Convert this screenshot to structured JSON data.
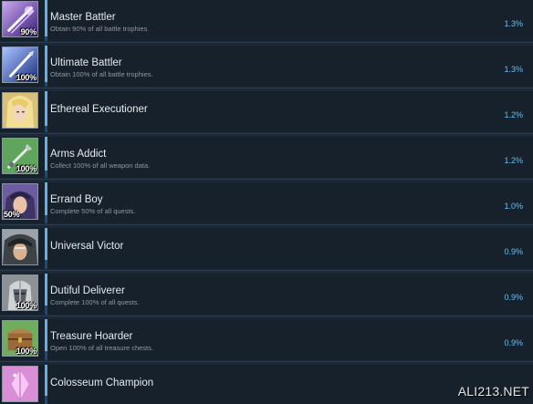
{
  "achievements": [
    {
      "title": "Master Battler",
      "description": "Obtain 90% of all battle trophies.",
      "rate": "1.3%",
      "badge": "90%",
      "icon": "sword-slash-purple-icon"
    },
    {
      "title": "Ultimate Battler",
      "description": "Obtain 100% of all battle trophies.",
      "rate": "1.3%",
      "badge": "100%",
      "icon": "sword-slash-blue-icon"
    },
    {
      "title": "Ethereal Executioner",
      "description": "",
      "rate": "1.2%",
      "badge": "",
      "icon": "blonde-character-portrait-icon"
    },
    {
      "title": "Arms Addict",
      "description": "Collect 100% of all weapon data.",
      "rate": "1.2%",
      "badge": "100%",
      "icon": "weapon-green-icon"
    },
    {
      "title": "Errand Boy",
      "description": "Complete 50% of all quests.",
      "rate": "1.0%",
      "badge": "50%",
      "icon": "character-portrait-purple-icon"
    },
    {
      "title": "Universal Victor",
      "description": "",
      "rate": "0.9%",
      "badge": "",
      "icon": "hooded-character-portrait-icon"
    },
    {
      "title": "Dutiful Deliverer",
      "description": "Complete 100% of all quests.",
      "rate": "0.9%",
      "badge": "100%",
      "icon": "helmet-knight-icon"
    },
    {
      "title": "Treasure Hoarder",
      "description": "Open 100% of all treasure chests.",
      "rate": "0.9%",
      "badge": "100%",
      "icon": "treasure-chest-icon"
    },
    {
      "title": "Colosseum Champion",
      "description": "",
      "rate": "",
      "badge": "",
      "icon": "pink-crystal-icon"
    }
  ],
  "watermark": "ALI213.NET",
  "colors": {
    "background": "#1b2838",
    "row": "#16212c",
    "accent": "#66aee6",
    "rate": "#66c0f4",
    "title": "#e6ebef",
    "description": "#8f98a0"
  }
}
